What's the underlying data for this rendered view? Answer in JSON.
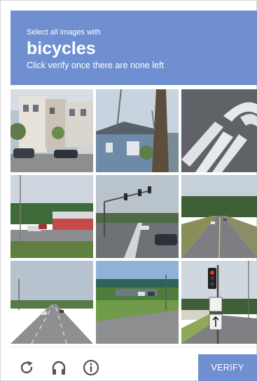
{
  "header": {
    "line1": "Select all images with",
    "target": "bicycles",
    "line3": "Click verify once there are none left"
  },
  "tiles": [
    "tile-townhouses-street",
    "tile-blue-house-palm",
    "tile-crosswalk-stripes",
    "tile-road-red-building",
    "tile-intersection-traffic-lights",
    "tile-two-lane-road",
    "tile-highway-lanes",
    "tile-overpass-lot",
    "tile-traffic-signal-sign"
  ],
  "footer": {
    "reload_icon": "reload-icon",
    "audio_icon": "headphones-icon",
    "info_icon": "info-icon",
    "verify_label": "VERIFY"
  },
  "colors": {
    "accent": "#6f8fd0",
    "icon_gray": "#555555"
  }
}
